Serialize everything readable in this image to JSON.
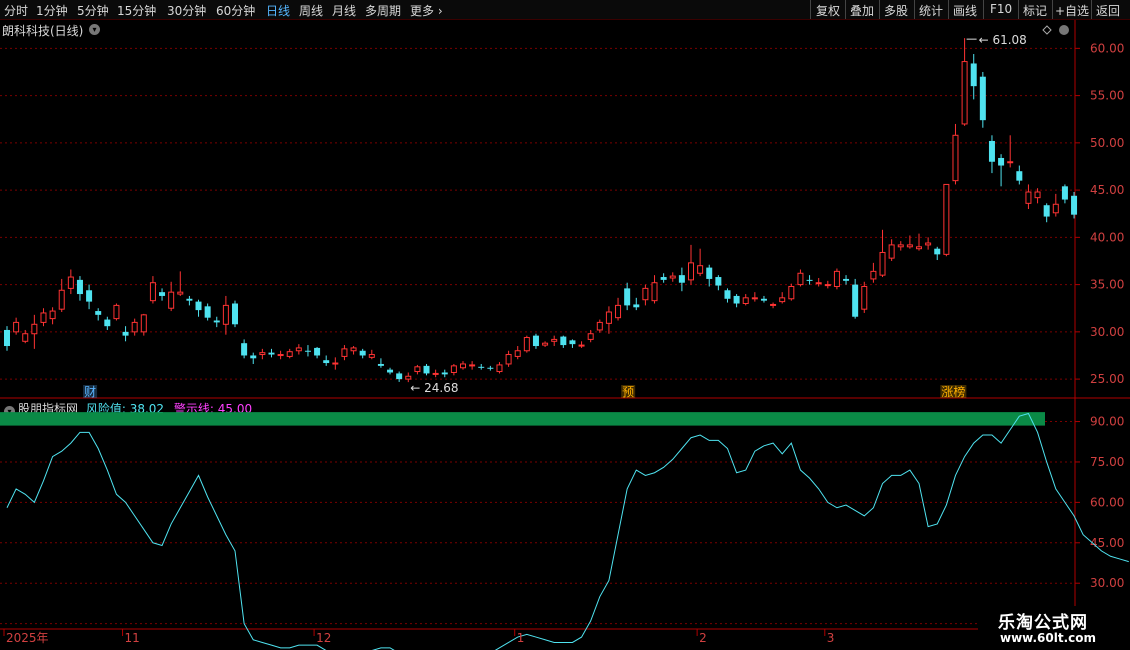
{
  "toolbar": {
    "periods": [
      "分时",
      "1分钟",
      "5分钟",
      "15分钟",
      "30分钟",
      "60分钟",
      "日线",
      "周线",
      "月线",
      "多周期",
      "更多"
    ],
    "active": "日线",
    "actions": [
      "复权",
      "叠加",
      "多股",
      "统计",
      "画线",
      "F10",
      "标记",
      "+自选",
      "返回"
    ]
  },
  "main": {
    "title": "朗科科技(日线)",
    "high_label": "61.08",
    "low_label": "24.68",
    "y_ticks": [
      "60.00",
      "55.00",
      "50.00",
      "45.00",
      "40.00",
      "35.00",
      "30.00",
      "25.00"
    ],
    "markers": [
      {
        "text": "财",
        "color": "#5ab4ff"
      },
      {
        "text": "预",
        "color": "#ffb000"
      },
      {
        "text": "涨榜",
        "color": "#ffb000"
      }
    ]
  },
  "indicator": {
    "name": "股朋指标网",
    "risk_label": "风险值: 38.02",
    "warn_label": "警示线: 45.00",
    "y_ticks": [
      "90.00",
      "75.00",
      "60.00",
      "45.00",
      "30.00",
      "15.00"
    ]
  },
  "x_axis": {
    "labels": [
      "2025年",
      "11",
      "12",
      "1",
      "2",
      "3"
    ]
  },
  "colors": {
    "up": "#ff3333",
    "down": "#4fe3f0",
    "grid": "#7a0000",
    "band": "#0a8a46",
    "line": "#4fe3f0",
    "risk": "#4fe3f0",
    "warn": "#ff40ff",
    "yellow": "#ffff40",
    "pink": "#ff40aa"
  },
  "watermark": {
    "line1": "乐淘公式网",
    "line2": "www.60lt.com"
  },
  "chart_data": {
    "type": "candlestick",
    "ylim": [
      23,
      63
    ],
    "candles": [
      [
        30.2,
        28.5,
        30.6,
        28.0
      ],
      [
        30.0,
        31.0,
        31.5,
        29.7
      ],
      [
        29.0,
        29.8,
        30.2,
        28.8
      ],
      [
        29.8,
        30.8,
        31.8,
        28.2
      ],
      [
        31.0,
        32.0,
        32.5,
        30.6
      ],
      [
        31.4,
        32.2,
        32.6,
        30.8
      ],
      [
        32.4,
        34.4,
        35.6,
        32.1
      ],
      [
        34.6,
        35.8,
        36.6,
        34.0
      ],
      [
        35.5,
        34.0,
        35.9,
        33.3
      ],
      [
        34.4,
        33.2,
        35.0,
        32.4
      ],
      [
        32.2,
        31.8,
        32.5,
        31.2
      ],
      [
        31.3,
        30.6,
        31.6,
        30.2
      ],
      [
        31.4,
        32.8,
        33.0,
        31.2
      ],
      [
        30.0,
        29.6,
        30.6,
        29.0
      ],
      [
        30.0,
        31.0,
        31.4,
        29.6
      ],
      [
        30.0,
        31.8,
        31.9,
        29.6
      ],
      [
        33.3,
        35.2,
        35.9,
        33.0
      ],
      [
        34.2,
        33.8,
        34.6,
        33.3
      ],
      [
        32.5,
        34.2,
        35.3,
        32.2
      ],
      [
        34.0,
        34.2,
        36.4,
        33.8
      ],
      [
        33.5,
        33.3,
        33.8,
        32.8
      ],
      [
        33.2,
        32.3,
        33.4,
        31.6
      ],
      [
        32.7,
        31.5,
        33.0,
        31.2
      ],
      [
        31.2,
        31.0,
        31.6,
        30.5
      ],
      [
        30.8,
        32.8,
        33.8,
        29.7
      ],
      [
        33.0,
        30.8,
        33.3,
        30.5
      ],
      [
        28.8,
        27.5,
        29.2,
        27.2
      ],
      [
        27.5,
        27.2,
        27.8,
        26.6
      ],
      [
        27.6,
        27.8,
        28.2,
        27.1
      ],
      [
        27.8,
        27.6,
        28.2,
        27.3
      ],
      [
        27.5,
        27.6,
        28.0,
        27.1
      ],
      [
        27.4,
        27.9,
        28.2,
        27.2
      ],
      [
        28.0,
        28.3,
        28.7,
        27.6
      ],
      [
        28.0,
        27.9,
        28.6,
        27.4
      ],
      [
        28.3,
        27.5,
        28.4,
        27.2
      ],
      [
        27.0,
        26.7,
        27.5,
        26.4
      ],
      [
        26.6,
        26.7,
        27.3,
        26.0
      ],
      [
        27.4,
        28.2,
        28.6,
        27.0
      ],
      [
        28.0,
        28.3,
        28.5,
        27.6
      ],
      [
        28.0,
        27.5,
        28.2,
        27.2
      ],
      [
        27.3,
        27.6,
        28.1,
        27.1
      ],
      [
        26.6,
        26.4,
        27.2,
        26.2
      ],
      [
        26.0,
        25.7,
        26.2,
        25.5
      ],
      [
        25.6,
        25.0,
        25.8,
        24.7
      ],
      [
        25.0,
        25.3,
        25.7,
        24.68
      ],
      [
        25.8,
        26.3,
        26.5,
        25.5
      ],
      [
        26.4,
        25.6,
        26.6,
        25.4
      ],
      [
        25.5,
        25.6,
        26.0,
        25.2
      ],
      [
        25.7,
        25.5,
        26.0,
        25.2
      ],
      [
        25.7,
        26.4,
        26.6,
        25.4
      ],
      [
        26.2,
        26.6,
        26.9,
        26.0
      ],
      [
        26.4,
        26.5,
        26.9,
        26.0
      ],
      [
        26.3,
        26.2,
        26.6,
        26.0
      ],
      [
        26.2,
        26.1,
        26.4,
        25.9
      ],
      [
        25.8,
        26.5,
        26.8,
        25.6
      ],
      [
        26.6,
        27.6,
        28.0,
        26.3
      ],
      [
        27.4,
        28.0,
        28.5,
        27.1
      ],
      [
        28.0,
        29.4,
        29.6,
        27.8
      ],
      [
        29.6,
        28.5,
        29.8,
        28.2
      ],
      [
        28.6,
        28.8,
        29.0,
        28.4
      ],
      [
        29.0,
        29.2,
        29.6,
        28.5
      ],
      [
        29.5,
        28.6,
        29.6,
        28.3
      ],
      [
        29.1,
        28.7,
        29.2,
        28.3
      ],
      [
        28.5,
        28.6,
        29.0,
        28.3
      ],
      [
        29.2,
        29.8,
        30.2,
        28.9
      ],
      [
        30.2,
        31.0,
        31.3,
        29.9
      ],
      [
        30.9,
        32.1,
        32.7,
        29.8
      ],
      [
        31.5,
        32.8,
        33.6,
        31.2
      ],
      [
        34.6,
        32.8,
        35.2,
        32.3
      ],
      [
        32.9,
        32.6,
        33.6,
        32.3
      ],
      [
        33.4,
        34.6,
        35.0,
        32.8
      ],
      [
        33.3,
        35.2,
        36.0,
        33.0
      ],
      [
        35.8,
        35.5,
        36.2,
        35.2
      ],
      [
        35.7,
        35.9,
        36.3,
        35.3
      ],
      [
        36.0,
        35.2,
        36.8,
        34.3
      ],
      [
        35.5,
        37.3,
        39.2,
        35.0
      ],
      [
        36.2,
        37.0,
        38.8,
        35.9
      ],
      [
        36.8,
        35.6,
        37.1,
        34.8
      ],
      [
        35.8,
        34.9,
        36.0,
        34.4
      ],
      [
        34.4,
        33.5,
        34.6,
        33.1
      ],
      [
        33.8,
        33.0,
        34.0,
        32.6
      ],
      [
        33.0,
        33.6,
        34.0,
        32.8
      ],
      [
        33.5,
        33.6,
        34.2,
        33.2
      ],
      [
        33.5,
        33.3,
        33.8,
        33.1
      ],
      [
        32.8,
        32.9,
        33.1,
        32.5
      ],
      [
        33.2,
        33.6,
        34.2,
        33.0
      ],
      [
        33.5,
        34.8,
        35.1,
        33.3
      ],
      [
        35.0,
        36.2,
        36.6,
        34.8
      ],
      [
        35.5,
        35.4,
        36.0,
        35.0
      ],
      [
        35.1,
        35.2,
        35.7,
        34.8
      ],
      [
        35.0,
        35.0,
        35.4,
        34.6
      ],
      [
        34.8,
        36.4,
        36.7,
        34.5
      ],
      [
        35.6,
        35.4,
        36.0,
        35.0
      ],
      [
        35.0,
        31.6,
        35.6,
        31.4
      ],
      [
        32.4,
        34.8,
        35.3,
        32.0
      ],
      [
        35.6,
        36.4,
        37.3,
        35.2
      ],
      [
        36.0,
        38.4,
        40.8,
        35.8
      ],
      [
        37.8,
        39.2,
        39.8,
        37.5
      ],
      [
        39.0,
        39.2,
        39.6,
        38.6
      ],
      [
        39.0,
        39.2,
        40.2,
        38.8
      ],
      [
        38.8,
        39.0,
        40.4,
        38.6
      ],
      [
        39.2,
        39.4,
        40.0,
        38.7
      ],
      [
        38.8,
        38.2,
        39.0,
        37.6
      ],
      [
        38.2,
        45.6,
        45.6,
        38.0
      ],
      [
        46.0,
        50.8,
        52.0,
        45.6
      ],
      [
        52.0,
        58.6,
        61.08,
        51.8
      ],
      [
        58.4,
        56.0,
        59.4,
        54.6
      ],
      [
        57.0,
        52.4,
        57.5,
        51.6
      ],
      [
        50.2,
        48.0,
        50.8,
        46.8
      ],
      [
        48.4,
        47.6,
        48.8,
        45.4
      ],
      [
        48.0,
        48.0,
        50.8,
        47.4
      ],
      [
        47.0,
        46.0,
        47.6,
        45.6
      ],
      [
        43.6,
        44.8,
        45.6,
        43.0
      ],
      [
        44.2,
        44.8,
        45.2,
        43.6
      ],
      [
        43.4,
        42.2,
        43.6,
        41.6
      ],
      [
        42.6,
        43.5,
        44.6,
        42.2
      ],
      [
        45.4,
        44.0,
        45.6,
        43.6
      ],
      [
        44.4,
        42.4,
        44.8,
        42.0
      ]
    ],
    "indicator_series": {
      "name": "风险值",
      "values": [
        58,
        65,
        63,
        60,
        68,
        77,
        79,
        82,
        86,
        86,
        80,
        72,
        63,
        60,
        55,
        50,
        45,
        44,
        52,
        58,
        64,
        70,
        62,
        55,
        48,
        42,
        15,
        9,
        8,
        7,
        6,
        6,
        7,
        7,
        7,
        5,
        3,
        3,
        2,
        3,
        5,
        6,
        6,
        4,
        3,
        0,
        -2,
        0,
        2,
        3,
        3,
        3,
        4,
        4,
        6,
        8,
        10,
        11,
        10,
        9,
        8,
        8,
        8,
        10,
        16,
        25,
        31,
        48,
        65,
        72,
        70,
        71,
        73,
        76,
        80,
        84,
        85,
        83,
        83,
        80,
        71,
        72,
        79,
        81,
        82,
        78,
        82,
        72,
        69,
        65,
        60,
        58,
        59,
        57,
        55,
        58,
        67,
        70,
        70,
        72,
        67,
        51,
        52,
        59,
        70,
        77,
        82,
        85,
        85,
        82,
        87,
        92,
        93,
        86,
        75,
        65,
        60,
        55,
        48,
        45,
        42,
        40,
        39,
        38.02
      ],
      "warn_line": 45.0,
      "ylim": [
        13,
        98
      ]
    }
  }
}
